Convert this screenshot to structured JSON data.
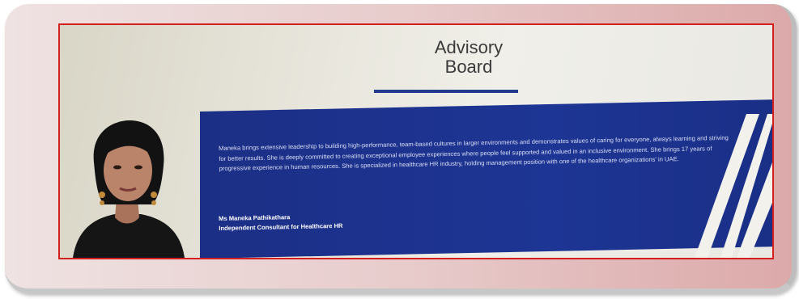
{
  "slide": {
    "heading_line1": "Advisory",
    "heading_line2": "Board",
    "bio": "Maneka brings extensive leadership to building high-performance, team-based cultures in larger environments and demonstrates values of caring for everyone, always learning and striving for better results. She is deeply committed to creating exceptional employee experiences where people feel supported and valued in an inclusive environment. She brings 17 years of progressive experience in human resources. She is specialized in healthcare HR industry, holding management position with one of the healthcare organizations' in UAE.",
    "name": "Ms Maneka Pathikathara",
    "title": "Independent Consultant for Healthcare HR"
  },
  "colors": {
    "frame_border": "#d41f1f",
    "panel_blue": "#1c2f86",
    "accent_bar": "#223b8f",
    "frame_bg": "#e8cccc"
  },
  "icons": {
    "portrait": "person-portrait-icon",
    "stripes": "diagonal-stripes-decoration"
  }
}
